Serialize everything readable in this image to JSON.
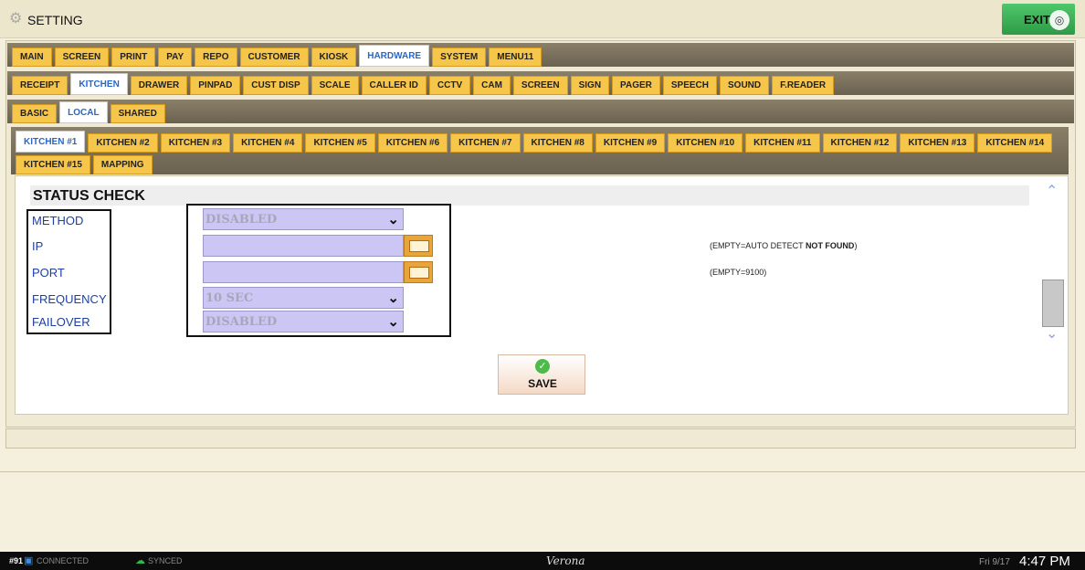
{
  "window": {
    "title": "SETTING",
    "exit_label": "EXIT"
  },
  "tabs_level1": [
    "MAIN",
    "SCREEN",
    "PRINT",
    "PAY",
    "REPO",
    "CUSTOMER",
    "KIOSK",
    "HARDWARE",
    "SYSTEM",
    "MENU11"
  ],
  "tabs_level2": [
    "RECEIPT",
    "KITCHEN",
    "DRAWER",
    "PINPAD",
    "CUST DISP",
    "SCALE",
    "CALLER ID",
    "CCTV",
    "CAM",
    "SCREEN",
    "SIGN",
    "PAGER",
    "SPEECH",
    "SOUND",
    "F.READER"
  ],
  "tabs_level3": [
    "BASIC",
    "LOCAL",
    "SHARED"
  ],
  "tabs_level4_row1": [
    "KITCHEN #1",
    "KITCHEN #2",
    "KITCHEN #3",
    "KITCHEN #4",
    "KITCHEN #5",
    "KITCHEN #6",
    "KITCHEN #7",
    "KITCHEN #8",
    "KITCHEN #9",
    "KITCHEN #10",
    "KITCHEN #11",
    "KITCHEN #12",
    "KITCHEN #13"
  ],
  "tabs_level4_row2": [
    "KITCHEN #14",
    "KITCHEN #15",
    "MAPPING"
  ],
  "active": {
    "level1": "HARDWARE",
    "level2": "KITCHEN",
    "level3": "LOCAL",
    "level4": "KITCHEN #1"
  },
  "section": {
    "title": "STATUS CHECK",
    "labels": {
      "method": "METHOD",
      "ip": "IP",
      "port": "PORT",
      "frequency": "FREQUENCY",
      "failover": "FAILOVER"
    },
    "values": {
      "method": "DISABLED",
      "ip": "",
      "port": "",
      "frequency": "10 SEC",
      "failover": "DISABLED"
    },
    "notes": {
      "ip_prefix": "(EMPTY=AUTO DETECT ",
      "ip_bold": "NOT FOUND",
      "ip_suffix": ")",
      "port": "(EMPTY=9100)"
    }
  },
  "save_label": "SAVE",
  "status_bar": {
    "station": "#91",
    "connected": "CONNECTED",
    "synced": "SYNCED",
    "store": "Verona",
    "date": "Fri 9/17",
    "time": "4:47 PM"
  },
  "colors": {
    "tab": "#f6c64a",
    "active_tab_text": "#2a66c8",
    "field": "#cbc6f4",
    "label": "#1f3fa0",
    "exit": "#3aaa55"
  }
}
